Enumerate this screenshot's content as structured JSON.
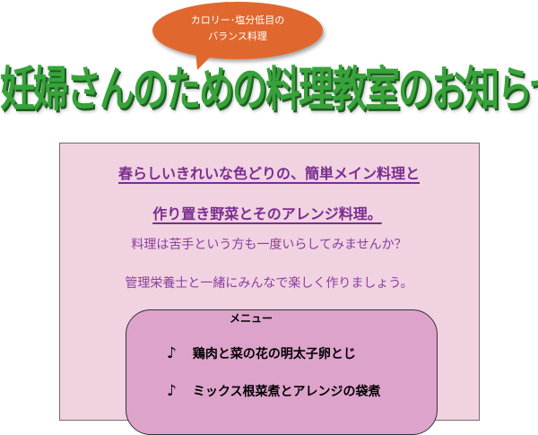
{
  "bubble": {
    "line1": "カロリー･塩分低目の",
    "line2": "バランス料理"
  },
  "headline": "妊婦さんのための料理教室のお知らせ",
  "intro": {
    "line1": "春らしいきれいな色どりの、簡単メイン料理と",
    "line2": "作り置き野菜とそのアレンジ料理。",
    "line3": "料理は苦手という方も一度いらしてみませんか？",
    "line4": "管理栄養士と一緒にみんなで楽しく作りましょう。"
  },
  "menu": {
    "title": "メニュー",
    "items": [
      {
        "bullet": "♪",
        "label": "鶏肉と菜の花の明太子卵とじ"
      },
      {
        "bullet": "♪",
        "label": "ミックス根菜煮とアレンジの袋煮"
      }
    ]
  },
  "colors": {
    "bubble": "#e0682f",
    "headline": "#37a33a",
    "panel": "#f1d2e1",
    "menu_box": "#dea3cb",
    "emphasis_text": "#7a2e8e"
  }
}
